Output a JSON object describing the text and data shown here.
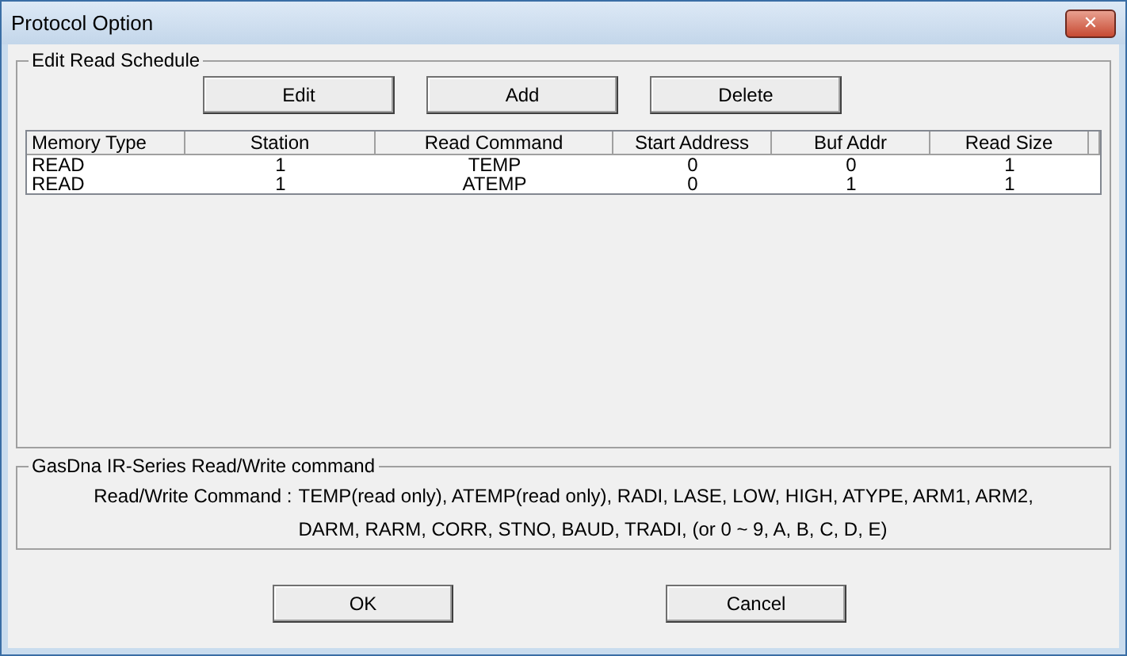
{
  "window": {
    "title": "Protocol Option",
    "close": "✕"
  },
  "schedule": {
    "title": "Edit Read Schedule",
    "buttons": [
      "Edit",
      "Add",
      "Delete"
    ],
    "columns": [
      "Memory Type",
      "Station",
      "Read Command",
      "Start Address",
      "Buf Addr",
      "Read Size"
    ],
    "rows": [
      {
        "cells": [
          "READ",
          "1",
          "TEMP",
          "0",
          "0",
          "1"
        ]
      },
      {
        "cells": [
          "READ",
          "1",
          "ATEMP",
          "0",
          "1",
          "1"
        ]
      }
    ]
  },
  "commands": {
    "title": "GasDna IR-Series Read/Write command",
    "label": "Read/Write Command :",
    "lines": [
      "TEMP(read only), ATEMP(read only), RADI, LASE, LOW, HIGH, ATYPE, ARM1, ARM2,",
      "DARM, RARM, CORR, STNO, BAUD, TRADI,  (or 0 ~ 9, A, B, C, D, E)"
    ]
  },
  "buttons": [
    "OK",
    "Cancel"
  ]
}
